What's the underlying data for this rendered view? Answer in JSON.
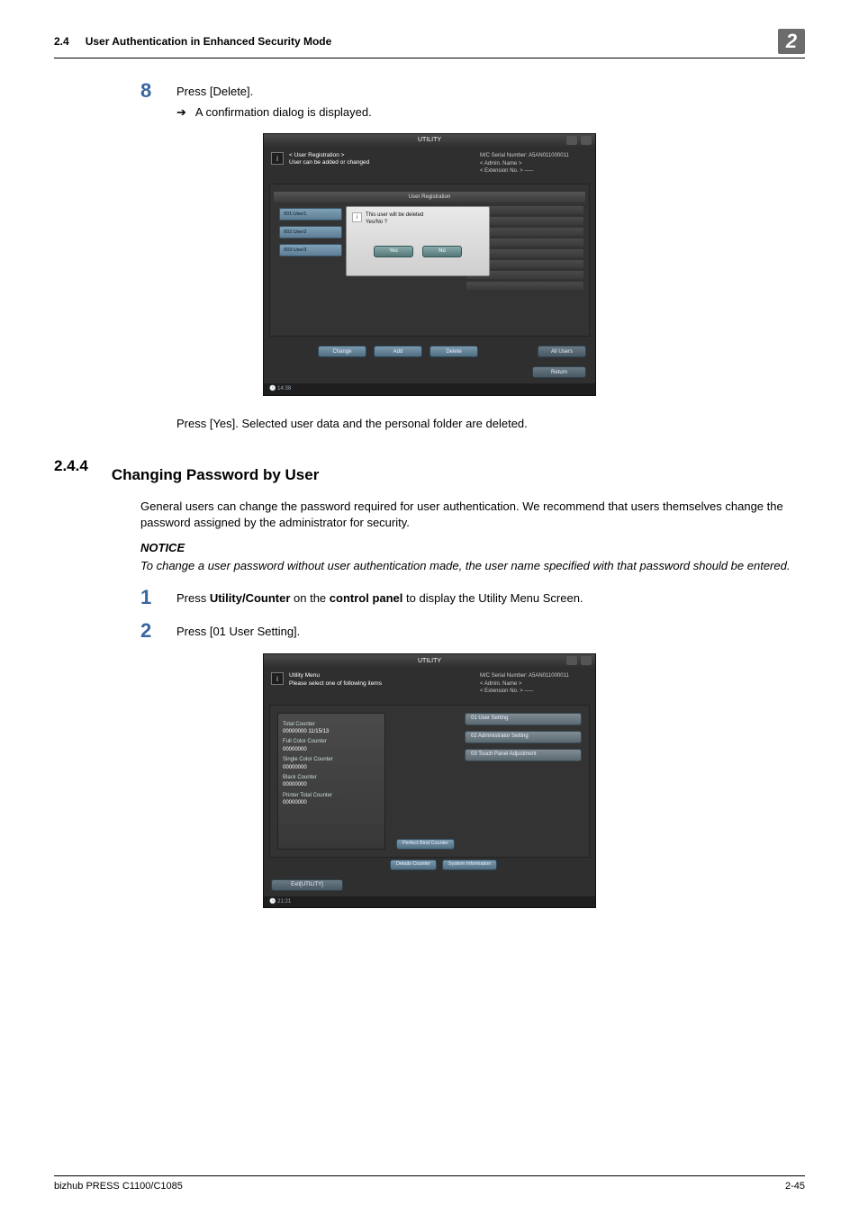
{
  "header": {
    "section_number": "2.4",
    "section_title": "User Authentication in Enhanced Security Mode",
    "chapter_badge": "2"
  },
  "step8": {
    "num": "8",
    "text": "Press [Delete].",
    "arrow_text": "A confirmation dialog is displayed."
  },
  "shot1": {
    "utility_label": "UTILITY",
    "head_line1": "< User Registration >",
    "head_line2": "User can be added or changed",
    "mc_line": "M/C Serial Number: A5AN011000011",
    "admin_line": "< Admin. Name >",
    "ext_line": "< Extension No. > -----",
    "panel_title": "User Registration",
    "users": [
      "001:User1",
      "002:User2",
      "003:User3"
    ],
    "dialog_line1": "This user will be deleted",
    "dialog_line2": "Yes/No ?",
    "yes": "Yes",
    "no": "No",
    "actions": {
      "change": "Change",
      "add": "Add",
      "delete": "Delete",
      "all": "All Users"
    },
    "return_btn": "Return",
    "time": "14:38"
  },
  "after_shot1": "Press [Yes]. Selected user data and the personal folder are deleted.",
  "sec244": {
    "num": "2.4.4",
    "title": "Changing Password by User",
    "para": "General users can change the password required for user authentication. We recommend that users themselves change the password assigned by the administrator for security.",
    "notice_label": "NOTICE",
    "notice_body": "To change a user password without user authentication made, the user name specified with that password should be entered."
  },
  "step1": {
    "num": "1",
    "pre": "Press ",
    "b1": "Utility/Counter",
    "mid": " on the ",
    "b2": "control panel",
    "post": " to display the Utility Menu Screen."
  },
  "step2": {
    "num": "2",
    "text": "Press [01 User Setting]."
  },
  "shot2": {
    "utility_label": "UTILITY",
    "head_line1": "Utility Menu",
    "head_line2": "Please select one of following items",
    "mc_line": "M/C Serial Number: A5AN011000011",
    "admin_line": "< Admin. Name >",
    "ext_line": "< Extension No. > -----",
    "counters": {
      "total_l": "Total Counter",
      "total_v": "00000000    11/15/13",
      "full_l": "Full Color Counter",
      "full_v": "00000000",
      "single_l": "Single Color Counter",
      "single_v": "00000000",
      "black_l": "Black Counter",
      "black_v": "00000000",
      "printer_l": "Printer Total Counter",
      "printer_v": "00000000"
    },
    "menu": {
      "m1": "01 User Setting",
      "m2": "02 Administrator Setting",
      "m3": "03 Touch Panel Adjustment"
    },
    "mini": {
      "a": "Perfect Bind Counter",
      "b": "Details Counter",
      "c": "System Information"
    },
    "exit": "Exit[UTILITY]",
    "time": "21:21"
  },
  "footer": {
    "left": "bizhub PRESS C1100/C1085",
    "right": "2-45"
  }
}
